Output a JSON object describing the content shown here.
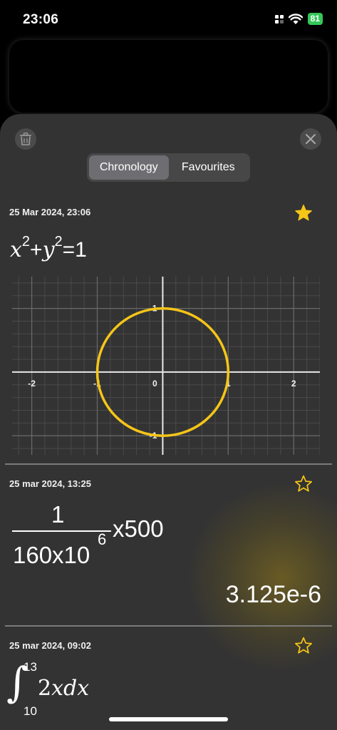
{
  "status_bar": {
    "time": "23:06",
    "battery": "81"
  },
  "history_header": {
    "tabs": [
      {
        "label": "Chronology",
        "active": true
      },
      {
        "label": "Favourites",
        "active": false
      }
    ]
  },
  "entries": [
    {
      "date": "25 Mar 2024, 23:06",
      "favourite": true,
      "equation": {
        "x": "x",
        "exp1": "2",
        "plus": "+",
        "y": "y",
        "exp2": "2",
        "rhs": "=1"
      },
      "graph": {
        "x_ticks": [
          "-2",
          "-1",
          "0",
          "1",
          "2"
        ],
        "y_ticks": [
          "1",
          "-1"
        ],
        "xlim": [
          -2.3,
          2.4
        ],
        "ylim": [
          -1.3,
          1.5
        ],
        "circle_radius": 1,
        "curve_color": "#f5c518"
      }
    },
    {
      "date": "25 mar 2024, 13:25",
      "favourite": false,
      "numerator": "1",
      "denominator": "160x10",
      "denominator_exp": "6",
      "multiplier": "x500",
      "result": "3.125e-6"
    },
    {
      "date": "25 mar 2024, 09:02",
      "favourite": false,
      "integral": {
        "sign": "∫",
        "upper": "13",
        "lower": "10",
        "integrand_coef": "2",
        "integrand_vars": "xdx"
      }
    }
  ],
  "colors": {
    "accent": "#f5c518",
    "sheet": "#333333",
    "tab_active": "#6e6e72"
  },
  "icons": {
    "trash": "trash-icon",
    "close": "close-icon",
    "star": "star-icon"
  }
}
